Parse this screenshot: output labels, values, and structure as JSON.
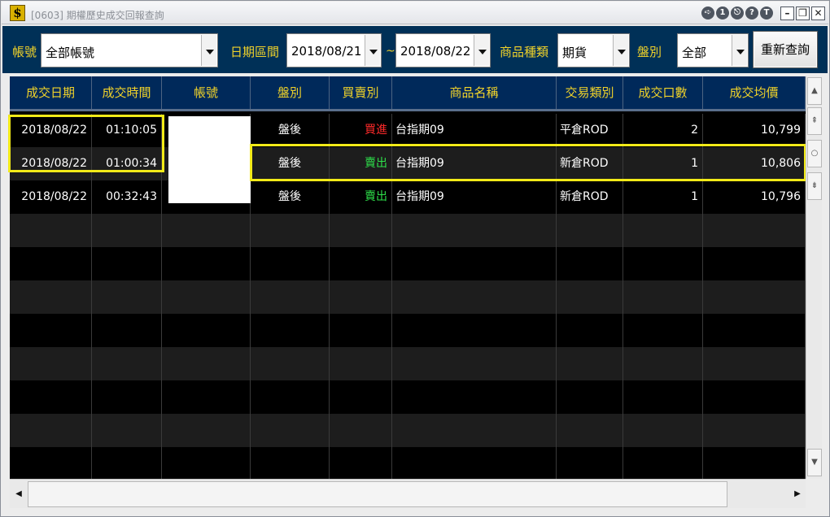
{
  "window": {
    "title": "[0603] 期權歷史成交回報查詢",
    "logo_text": "$",
    "title_buttons": [
      "➪",
      "1",
      "⎋",
      "?",
      "T"
    ],
    "window_buttons": {
      "minimize": "–",
      "restore": "❐",
      "close": "✕"
    }
  },
  "toolbar": {
    "account_label": "帳號",
    "account_value": "全部帳號",
    "date_range_label": "日期區間",
    "date_from": "2018/08/21",
    "date_separator": "~",
    "date_to": "2018/08/22",
    "product_type_label": "商品種類",
    "product_type_value": "期貨",
    "session_label": "盤別",
    "session_value": "全部",
    "requery_label": "重新查詢"
  },
  "table": {
    "columns": [
      "成交日期",
      "成交時間",
      "帳號",
      "盤別",
      "買賣別",
      "商品名稱",
      "交易類別",
      "成交口數",
      "成交均價"
    ],
    "rows": [
      {
        "date": "2018/08/22",
        "time": "01:10:05",
        "account": "",
        "session": "盤後",
        "side": "買進",
        "side_type": "buy",
        "product": "台指期09",
        "trade_type": "平倉ROD",
        "qty": "2",
        "avg_price": "10,799"
      },
      {
        "date": "2018/08/22",
        "time": "01:00:34",
        "account": "",
        "session": "盤後",
        "side": "賣出",
        "side_type": "sell",
        "product": "台指期09",
        "trade_type": "新倉ROD",
        "qty": "1",
        "avg_price": "10,806"
      },
      {
        "date": "2018/08/22",
        "time": "00:32:43",
        "account": "",
        "session": "盤後",
        "side": "賣出",
        "side_type": "sell",
        "product": "台指期09",
        "trade_type": "新倉ROD",
        "qty": "1",
        "avg_price": "10,796"
      }
    ],
    "empty_rows": 8
  },
  "colors": {
    "toolbar_bg": "#003057",
    "header_text": "#f0d22a",
    "buy": "#ff2a2a",
    "sell": "#2ee04a",
    "highlight": "#f2ea18"
  }
}
